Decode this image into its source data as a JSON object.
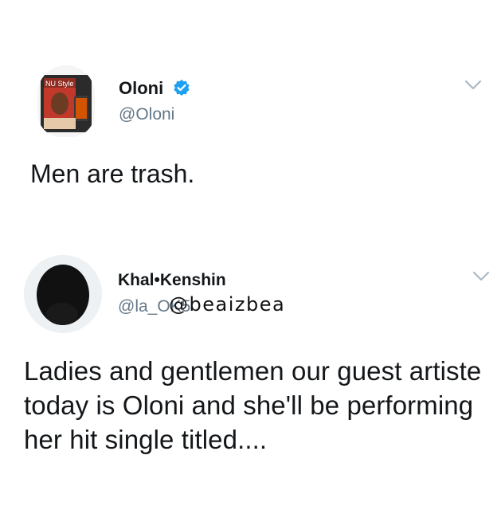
{
  "tweets": [
    {
      "name": "Oloni",
      "handle": "@Oloni",
      "verified": true,
      "text": "Men are trash.",
      "avatar_text": "NU Style"
    },
    {
      "name": "Khal•Kenshin",
      "handle": "@la_OK5",
      "verified": false,
      "text": "Ladies and gentlemen our guest artiste today is Oloni and she'll be performing her hit single titled...."
    }
  ],
  "watermark": "@beaizbea",
  "colors": {
    "verified_blue": "#1da1f2",
    "handle_gray": "#657786",
    "chevron_gray": "#aab8c2",
    "text": "#14171a"
  }
}
